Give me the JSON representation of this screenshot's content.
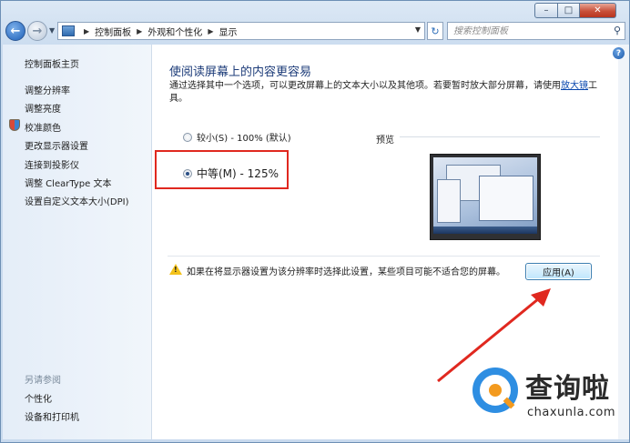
{
  "window": {
    "caption_buttons": {
      "minimize": "–",
      "maximize": "□",
      "close": "✕"
    }
  },
  "nav": {
    "back_glyph": "←",
    "forward_glyph": "→",
    "breadcrumbs": [
      "控制面板",
      "外观和个性化",
      "显示"
    ],
    "refresh_glyph": "↻",
    "search_placeholder": "搜索控制面板"
  },
  "sidebar": {
    "items": [
      {
        "label": "控制面板主页",
        "icon": null
      },
      {
        "label": "调整分辨率",
        "icon": null
      },
      {
        "label": "调整亮度",
        "icon": null
      },
      {
        "label": "校准颜色",
        "icon": "shield-icon"
      },
      {
        "label": "更改显示器设置",
        "icon": null
      },
      {
        "label": "连接到投影仪",
        "icon": null
      },
      {
        "label": "调整 ClearType 文本",
        "icon": null
      },
      {
        "label": "设置自定义文本大小(DPI)",
        "icon": null
      }
    ],
    "see_also_heading": "另请参阅",
    "see_also": [
      {
        "label": "个性化"
      },
      {
        "label": "设备和打印机"
      }
    ]
  },
  "main": {
    "title": "使阅读屏幕上的内容更容易",
    "description_prefix": "通过选择其中一个选项，可以更改屏幕上的文本大小以及其他项。若要暂时放大部分屏幕，请使用",
    "description_link": "放大镜",
    "description_suffix": "工具。",
    "options": [
      {
        "label": "较小(S) - 100% (默认)",
        "selected": false
      },
      {
        "label": "中等(M) - 125%",
        "selected": true
      }
    ],
    "preview_label": "预览",
    "warning_text": "如果在将显示器设置为该分辨率时选择此设置，某些项目可能不适合您的屏幕。",
    "apply_label": "应用(A)",
    "help_glyph": "?"
  },
  "watermark": {
    "brand_cn": "查询啦",
    "brand_en": "chaxunla.com"
  },
  "colors": {
    "highlight_red": "#e0281f",
    "arrow_red": "#e0281f",
    "link_blue": "#0645ad",
    "title_blue": "#1e3d7a"
  }
}
